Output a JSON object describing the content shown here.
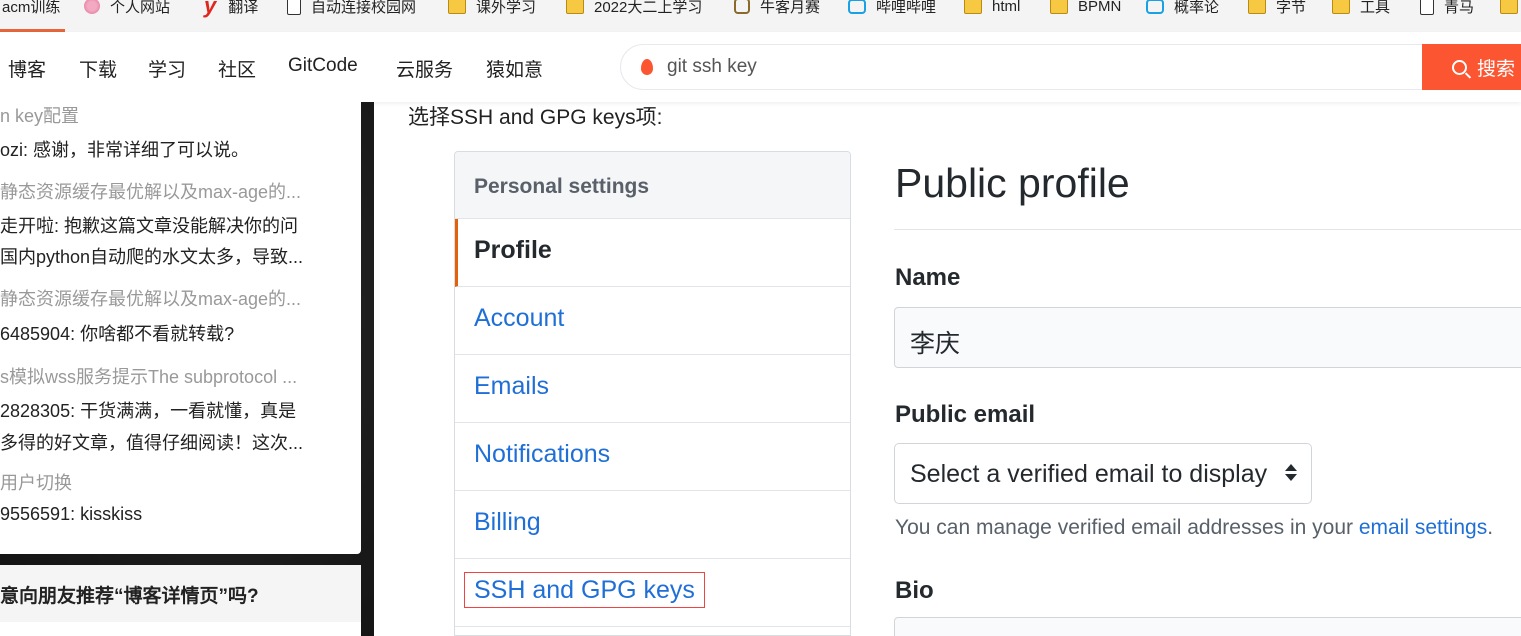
{
  "bookmarks": [
    {
      "label": "acm训练",
      "icon": "none"
    },
    {
      "label": "个人网站",
      "icon": "flower-icon"
    },
    {
      "label": "翻译",
      "icon": "youdao-icon"
    },
    {
      "label": "自动连接校园网",
      "icon": "document-icon"
    },
    {
      "label": "课外学习",
      "icon": "folder-icon"
    },
    {
      "label": "2022大二上学习",
      "icon": "folder-icon"
    },
    {
      "label": "牛客月赛",
      "icon": "nowcoder-icon"
    },
    {
      "label": "哔哩哔哩",
      "icon": "bilibili-icon"
    },
    {
      "label": "html",
      "icon": "folder-icon"
    },
    {
      "label": "BPMN",
      "icon": "folder-icon"
    },
    {
      "label": "概率论",
      "icon": "bilibili-icon"
    },
    {
      "label": "字节",
      "icon": "folder-icon"
    },
    {
      "label": "工具",
      "icon": "folder-icon"
    },
    {
      "label": "青马",
      "icon": "document-icon"
    }
  ],
  "nav": {
    "items": [
      "博客",
      "下载",
      "学习",
      "社区",
      "GitCode",
      "云服务",
      "猿如意"
    ]
  },
  "search": {
    "query": "git ssh key",
    "button_label": "搜索"
  },
  "comments": [
    {
      "title": "n key配置",
      "text": "ozi: 感谢，非常详细了可以说。"
    },
    {
      "title": "静态资源缓存最优解以及max-age的...",
      "text": "走开啦: 抱歉这篇文章没能解决你的问",
      "text2": "国内python自动爬的水文太多，导致..."
    },
    {
      "title": "静态资源缓存最优解以及max-age的...",
      "text": "6485904: 你啥都不看就转载?"
    },
    {
      "title": "s模拟wss服务提示The subprotocol ...",
      "text": "2828305: 干货满满，一看就懂，真是",
      "text2": "多得的好文章，值得仔细阅读！这次..."
    },
    {
      "title": "用户切换",
      "text": "9556591: kisskiss"
    }
  ],
  "recommend_text": "意向朋友推荐“博客详情页”吗?",
  "article": {
    "caption": "选择SSH and GPG keys项:"
  },
  "settings": {
    "header": "Personal settings",
    "items": [
      "Profile",
      "Account",
      "Emails",
      "Notifications",
      "Billing",
      "SSH and GPG keys"
    ]
  },
  "profile": {
    "title": "Public profile",
    "name_label": "Name",
    "name_value": "李庆",
    "email_label": "Public email",
    "email_select": "Select a verified email to display",
    "email_note": "You can manage verified email addresses in your ",
    "email_note_link": "email settings",
    "email_note_end": ".",
    "bio_label": "Bio"
  },
  "colors": {
    "accent": "#fc5531",
    "link": "#1f6fd6",
    "selected_bar": "#e36209",
    "highlight_box": "#ee4444"
  }
}
